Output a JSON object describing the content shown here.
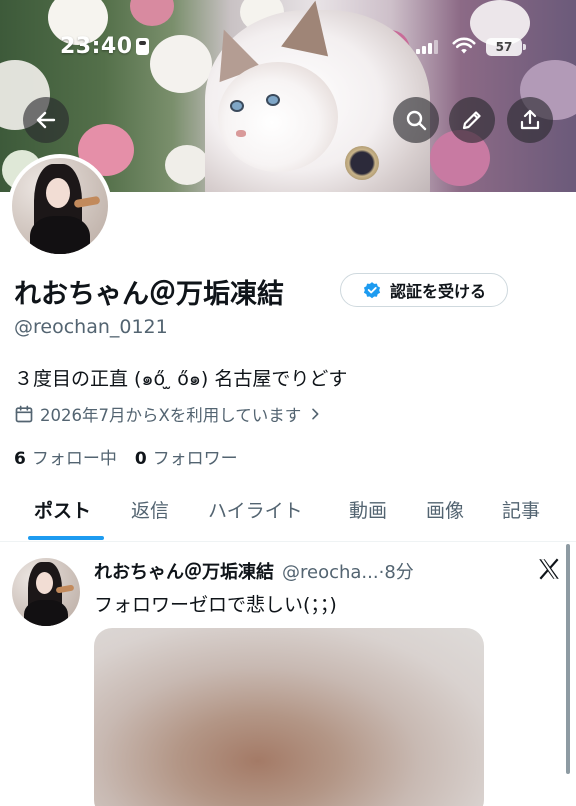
{
  "status_bar": {
    "time": "23:40",
    "battery": "57"
  },
  "profile": {
    "display_name": "れおちゃん＠万垢凍結",
    "verify_label": "認証を受ける",
    "handle": "@reochan_0121",
    "bio": "３度目の正直 (๑ő ̫ ő๑) 名古屋でりどす",
    "joined": "2026年7月からXを利用しています",
    "following_count": "6",
    "following_label": "フォロー中",
    "followers_count": "0",
    "followers_label": "フォロワー"
  },
  "tabs": [
    "ポスト",
    "返信",
    "ハイライト",
    "動画",
    "画像",
    "記事"
  ],
  "post": {
    "name": "れおちゃん＠万垢凍結",
    "handle_time": "@reocha...·8分",
    "text": "フォロワーゼロで悲しい(；；)"
  },
  "icons": {
    "back": "back-arrow-icon",
    "search": "search-icon",
    "edit": "pencil-icon",
    "share": "share-icon",
    "verified": "verified-badge-icon",
    "calendar": "calendar-icon",
    "x_logo": "x-logo-icon"
  },
  "colors": {
    "accent": "#1d9bf0",
    "text": "#0f1419",
    "muted": "#536471"
  }
}
